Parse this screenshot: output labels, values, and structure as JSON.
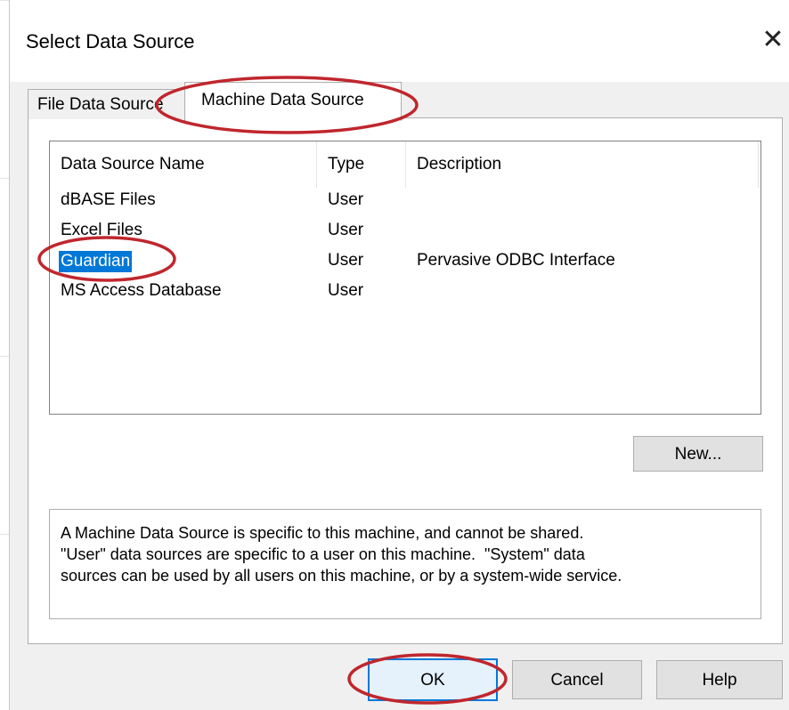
{
  "dialog": {
    "title": "Select Data Source",
    "close_glyph": "✕"
  },
  "tabs": [
    {
      "label": "File Data Source",
      "active": false
    },
    {
      "label": "Machine Data Source",
      "active": true
    }
  ],
  "list": {
    "columns": [
      "Data Source Name",
      "Type",
      "Description"
    ],
    "rows": [
      {
        "name": "dBASE Files",
        "type": "User",
        "description": ""
      },
      {
        "name": "Excel Files",
        "type": "User",
        "description": ""
      },
      {
        "name": "Guardian",
        "type": "User",
        "description": "Pervasive ODBC Interface",
        "selected": true
      },
      {
        "name": "MS Access Database",
        "type": "User",
        "description": ""
      }
    ]
  },
  "buttons": {
    "new_label": "New...",
    "ok_label": "OK",
    "cancel_label": "Cancel",
    "help_label": "Help"
  },
  "info_text": {
    "line1": "A Machine Data Source is specific to this machine, and cannot be shared.",
    "line2": "\"User\" data sources are specific to a user on this machine.  \"System\" data",
    "line3": "sources can be used by all users on this machine, or by a system-wide service."
  },
  "colors": {
    "selection": "#0078d7",
    "annotation": "#c0262d",
    "dialog_bg": "#f0f0f0"
  },
  "icons": {
    "close": "close-icon"
  }
}
